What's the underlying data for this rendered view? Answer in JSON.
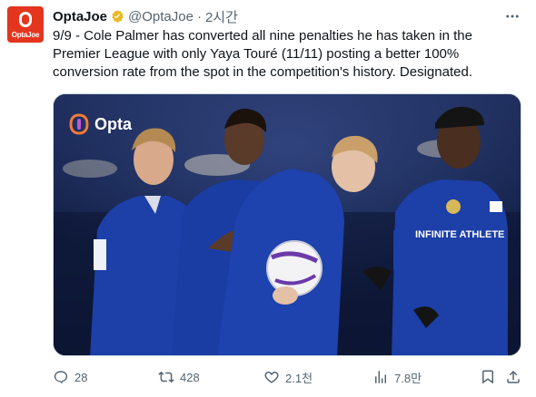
{
  "account": {
    "name": "OptaJoe",
    "handle": "@OptaJoe",
    "separator": "·",
    "time": "2시간",
    "avatar_text": "OptaJoe",
    "avatar_color": "#e4351f"
  },
  "tweet": {
    "text": "9/9 - Cole Palmer has converted all nine penalties he has taken in the Premier League with only Yaya Touré (11/11) posting a better 100% conversion rate from the spot in the competition's history. Designated."
  },
  "media": {
    "brand_label": "Opta",
    "sponsor_text": "INFINITE ATHLETE"
  },
  "actions": {
    "replies": "28",
    "reposts": "428",
    "likes": "2.1천",
    "views": "7.8만"
  },
  "colors": {
    "text_primary": "#0f1419",
    "text_secondary": "#536471",
    "verified_gold": "#e8b923",
    "kit_blue": "#1c3fa8"
  }
}
